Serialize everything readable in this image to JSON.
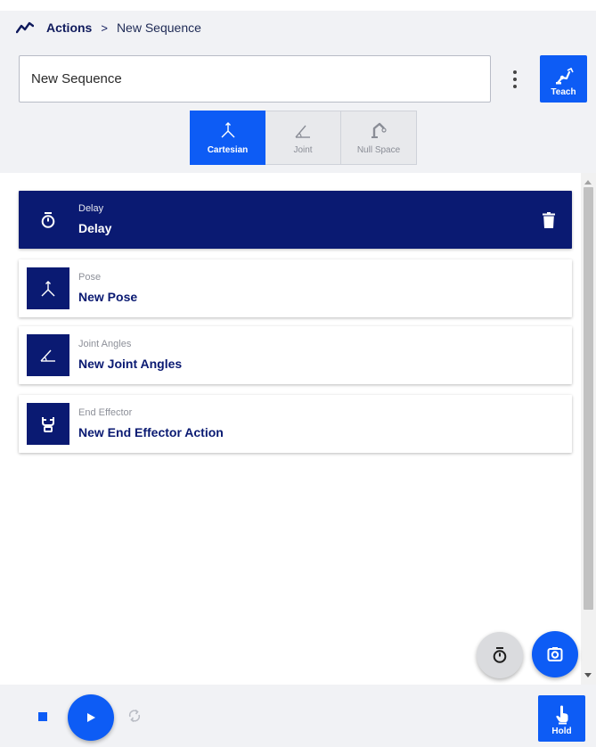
{
  "breadcrumb": {
    "root": "Actions",
    "separator": ">",
    "current": "New Sequence"
  },
  "sequence": {
    "name_value": "New Sequence",
    "teach_label": "Teach"
  },
  "modes": [
    {
      "label": "Cartesian",
      "active": true,
      "icon": "cartesian-axes-icon"
    },
    {
      "label": "Joint",
      "active": false,
      "icon": "joint-angle-icon"
    },
    {
      "label": "Null Space",
      "active": false,
      "icon": "robot-arm-icon"
    }
  ],
  "actions": [
    {
      "type": "Delay",
      "title": "Delay",
      "icon": "timer-icon",
      "selected": true
    },
    {
      "type": "Pose",
      "title": "New Pose",
      "icon": "cartesian-axes-icon",
      "selected": false
    },
    {
      "type": "Joint Angles",
      "title": "New Joint Angles",
      "icon": "joint-angle-icon",
      "selected": false
    },
    {
      "type": "End Effector",
      "title": "New End Effector Action",
      "icon": "gripper-icon",
      "selected": false
    }
  ],
  "bottom": {
    "hold_label": "Hold"
  },
  "colors": {
    "primary": "#0d5cf5",
    "navy": "#0a1a72",
    "panel": "#f1f2f5"
  }
}
